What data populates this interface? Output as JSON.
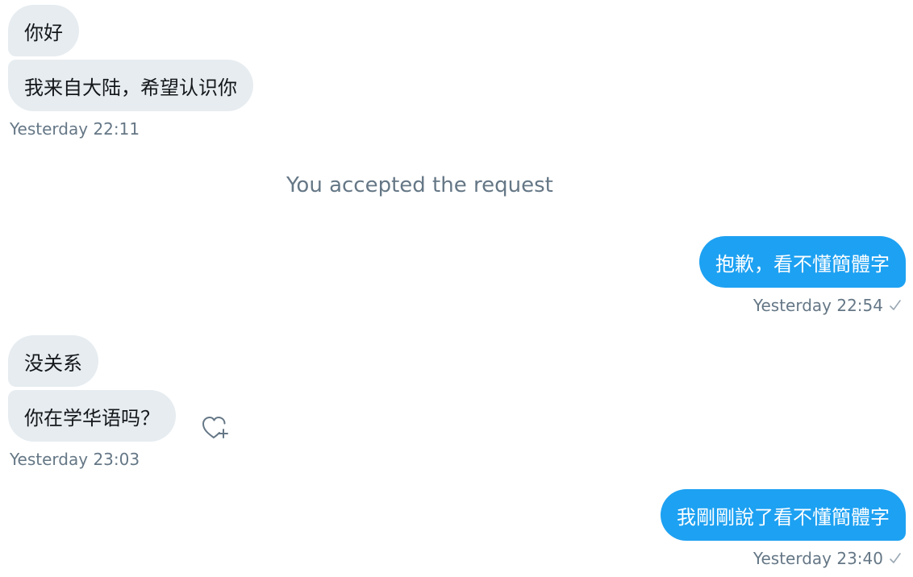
{
  "conversation": {
    "group1": {
      "messages": [
        "你好",
        "我来自大陆，希望认识你"
      ],
      "timestamp": "Yesterday 22:11"
    },
    "system_notice": "You accepted the request",
    "group2": {
      "messages": [
        "抱歉，看不懂簡體字"
      ],
      "timestamp": "Yesterday 22:54",
      "status_icon": "checkmark-icon"
    },
    "group3": {
      "messages": [
        "没关系",
        "你在学华语吗？"
      ],
      "timestamp": "Yesterday 23:03",
      "reaction_icon": "heart-plus-icon"
    },
    "group4": {
      "messages": [
        "我剛剛說了看不懂簡體字"
      ],
      "timestamp": "Yesterday 23:40",
      "status_icon": "checkmark-icon"
    }
  },
  "colors": {
    "incoming_bubble": "#e6ecf0",
    "outgoing_bubble": "#1da1f2",
    "meta_text": "#657786"
  }
}
